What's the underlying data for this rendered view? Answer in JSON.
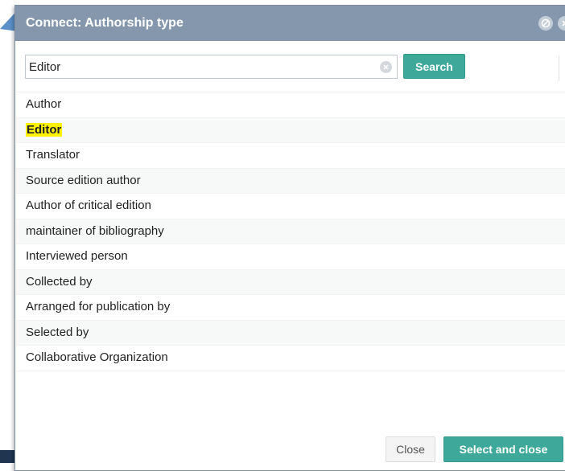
{
  "dialog": {
    "title": "Connect: Authorship type",
    "header_icons": [
      "settings-icon",
      "close-icon"
    ]
  },
  "search": {
    "value": "Editor",
    "button_label": "Search"
  },
  "list": {
    "items": [
      "Author",
      "Editor",
      "Translator",
      "Source edition author",
      "Author of critical edition",
      "maintainer of bibliography",
      "Interviewed person",
      "Collected by",
      "Arranged for publication by",
      "Selected by",
      "Collaborative Organization"
    ],
    "highlighted_index": 1
  },
  "footer": {
    "close_label": "Close",
    "select_close_label": "Select and close"
  },
  "colors": {
    "titlebar": "#8497ac",
    "accent": "#3ea89a",
    "highlight": "#fff200"
  }
}
